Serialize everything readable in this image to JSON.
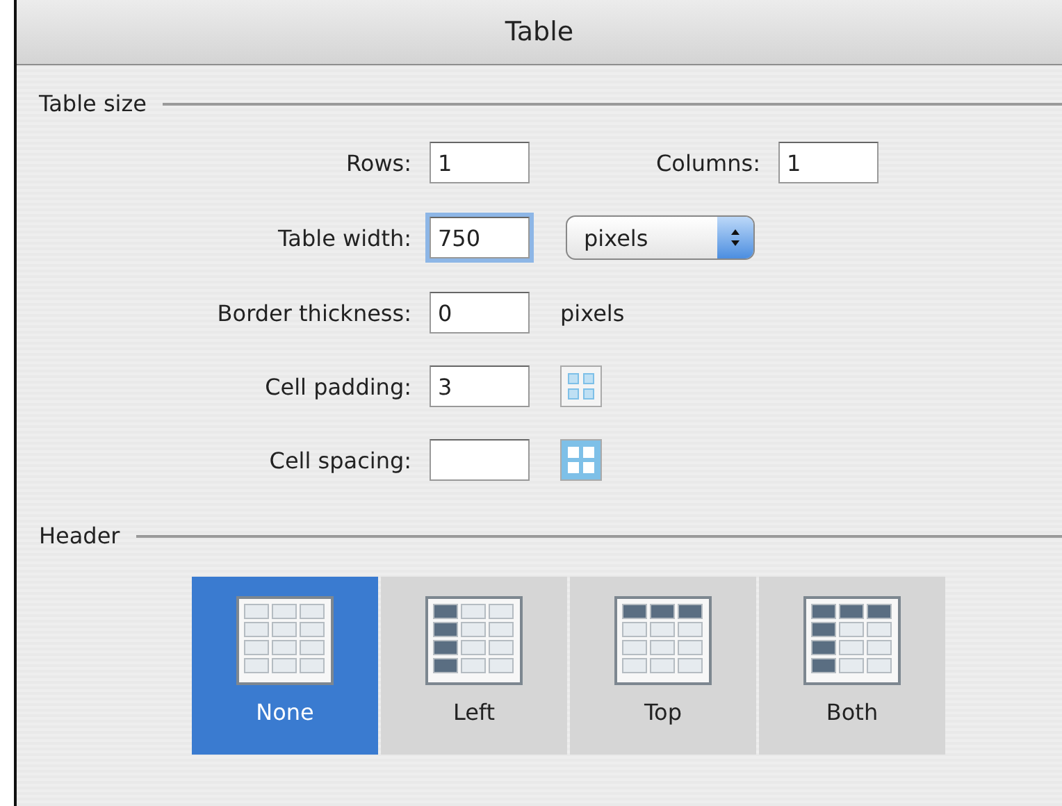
{
  "window": {
    "title": "Table"
  },
  "table_size": {
    "title": "Table size",
    "rows": {
      "label": "Rows:",
      "value": "1",
      "focused": false
    },
    "columns": {
      "label": "Columns:",
      "value": "1",
      "focused": false
    },
    "table_width": {
      "label": "Table width:",
      "value": "750",
      "focused": true,
      "unit_select": "pixels"
    },
    "border_thickness": {
      "label": "Border thickness:",
      "value": "0",
      "focused": false,
      "unit": "pixels"
    },
    "cell_padding": {
      "label": "Cell padding:",
      "value": "3",
      "focused": false
    },
    "cell_spacing": {
      "label": "Cell spacing:",
      "focused": false
    }
  },
  "header": {
    "title": "Header",
    "options": [
      {
        "label": "None",
        "kind": "none",
        "selected": true
      },
      {
        "label": "Left",
        "kind": "left",
        "selected": false
      },
      {
        "label": "Top",
        "kind": "top",
        "selected": false
      },
      {
        "label": "Both",
        "kind": "both",
        "selected": false
      }
    ]
  }
}
